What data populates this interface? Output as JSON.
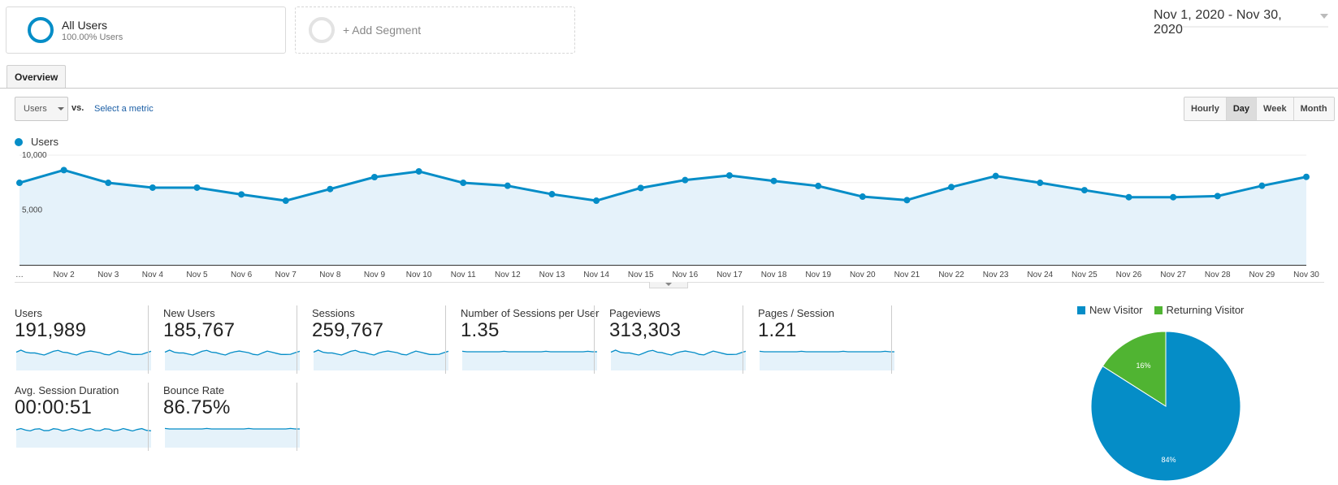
{
  "segments": {
    "all_users": {
      "title": "All Users",
      "subtitle": "100.00% Users"
    },
    "add_segment": {
      "label": "+ Add Segment"
    }
  },
  "date_range": {
    "label": "Nov 1, 2020 - Nov 30, 2020"
  },
  "tabs": [
    {
      "label": "Overview",
      "active": true
    }
  ],
  "metric_selector": {
    "selected": "Users",
    "vs_label": "vs.",
    "compare_link": "Select a metric"
  },
  "granularity": {
    "options": [
      {
        "label": "Hourly",
        "active": false
      },
      {
        "label": "Day",
        "active": true
      },
      {
        "label": "Week",
        "active": false
      },
      {
        "label": "Month",
        "active": false
      }
    ]
  },
  "colors": {
    "primary": "#058dc7",
    "area_fill": "#e5f2fa",
    "returning": "#50b432",
    "grid": "#eeeeee"
  },
  "chart_data": [
    {
      "type": "area",
      "title": "",
      "series": [
        {
          "name": "Users",
          "values": [
            7480,
            8640,
            7480,
            7040,
            7040,
            6420,
            5850,
            6910,
            8000,
            8520,
            7480,
            7210,
            6440,
            5850,
            7010,
            7730,
            8150,
            7650,
            7190,
            6220,
            5900,
            7090,
            8100,
            7480,
            6810,
            6170,
            6170,
            6270,
            7210,
            8020
          ]
        }
      ],
      "x": [
        "Nov 1",
        "Nov 2",
        "Nov 3",
        "Nov 4",
        "Nov 5",
        "Nov 6",
        "Nov 7",
        "Nov 8",
        "Nov 9",
        "Nov 10",
        "Nov 11",
        "Nov 12",
        "Nov 13",
        "Nov 14",
        "Nov 15",
        "Nov 16",
        "Nov 17",
        "Nov 18",
        "Nov 19",
        "Nov 20",
        "Nov 21",
        "Nov 22",
        "Nov 23",
        "Nov 24",
        "Nov 25",
        "Nov 26",
        "Nov 27",
        "Nov 28",
        "Nov 29",
        "Nov 30"
      ],
      "x_tick_labels": [
        "…",
        "Nov 2",
        "Nov 3",
        "Nov 4",
        "Nov 5",
        "Nov 6",
        "Nov 7",
        "Nov 8",
        "Nov 9",
        "Nov 10",
        "Nov 11",
        "Nov 12",
        "Nov 13",
        "Nov 14",
        "Nov 15",
        "Nov 16",
        "Nov 17",
        "Nov 18",
        "Nov 19",
        "Nov 20",
        "Nov 21",
        "Nov 22",
        "Nov 23",
        "Nov 24",
        "Nov 25",
        "Nov 26",
        "Nov 27",
        "Nov 28",
        "Nov 29",
        "Nov 30"
      ],
      "y_tick_labels": [
        {
          "value": 10000,
          "label": "10,000"
        },
        {
          "value": 5000,
          "label": "5,000"
        }
      ],
      "ylim": [
        0,
        10000
      ],
      "grid": true,
      "legend": {
        "position": "top-left",
        "entries": [
          "Users"
        ]
      }
    },
    {
      "type": "pie",
      "title": "",
      "categories": [
        "New Visitor",
        "Returning Visitor"
      ],
      "values": [
        84,
        16
      ],
      "labels": [
        "84%",
        "16%"
      ],
      "colors": [
        "#058dc7",
        "#50b432"
      ],
      "legend": {
        "position": "top",
        "entries": [
          "New Visitor",
          "Returning Visitor"
        ]
      }
    }
  ],
  "metrics": [
    {
      "label": "Users",
      "value": "191,989",
      "spark": "trend"
    },
    {
      "label": "New Users",
      "value": "185,767",
      "spark": "trend"
    },
    {
      "label": "Sessions",
      "value": "259,767",
      "spark": "trend"
    },
    {
      "label": "Number of Sessions per User",
      "value": "1.35",
      "spark": "flat"
    },
    {
      "label": "Pageviews",
      "value": "313,303",
      "spark": "trend"
    },
    {
      "label": "Pages / Session",
      "value": "1.21",
      "spark": "flat"
    },
    {
      "label": "Avg. Session Duration",
      "value": "00:00:51",
      "spark": "wiggle"
    },
    {
      "label": "Bounce Rate",
      "value": "86.75%",
      "spark": "flat"
    }
  ]
}
